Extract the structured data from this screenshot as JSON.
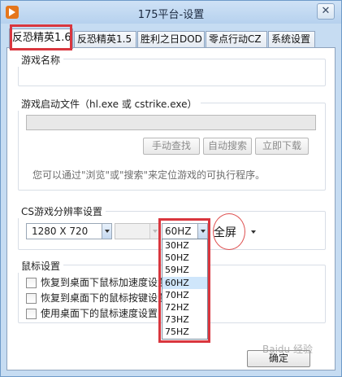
{
  "window": {
    "title": "175平台-设置",
    "close_glyph": "✕",
    "icon": "app-logo-icon"
  },
  "tabs": [
    {
      "label": "反恐精英1.6",
      "active": true
    },
    {
      "label": "反恐精英1.5",
      "active": false
    },
    {
      "label": "胜利之日DOD",
      "active": false
    },
    {
      "label": "零点行动CZ",
      "active": false
    },
    {
      "label": "系统设置",
      "active": false
    }
  ],
  "game_name_group": {
    "title": "游戏名称"
  },
  "launch_file_group": {
    "title": "游戏启动文件（hl.exe 或 cstrike.exe）",
    "path_value": "",
    "buttons": {
      "manual_find": "手动查找",
      "auto_search": "自动搜索",
      "download_now": "立即下载"
    },
    "hint": "您可以通过\"浏览\"或\"搜索\"来定位游戏的可执行程序。"
  },
  "resolution_group": {
    "title": "CS游戏分辨率设置",
    "resolution_value": "1280 X 720",
    "color_depth_value": "",
    "refresh_value": "60HZ",
    "refresh_options": [
      "30HZ",
      "50HZ",
      "59HZ",
      "60HZ",
      "70HZ",
      "72HZ",
      "73HZ",
      "75HZ"
    ],
    "refresh_selected_index": 3,
    "display_mode_value": "全屏"
  },
  "mouse_group": {
    "title": "鼠标设置",
    "options": [
      {
        "label": "恢复到桌面下鼠标加速度设置",
        "checked": false
      },
      {
        "label": "恢复到桌面下的鼠标按键设置",
        "checked": false
      },
      {
        "label": "使用桌面下的鼠标速度设置",
        "checked": false
      }
    ]
  },
  "footer": {
    "ok_label": "确定"
  },
  "watermark": "Baidu 经验",
  "colors": {
    "annotation_red": "#d9363e",
    "window_blue": "#c6dcf2",
    "selected_option": "#cfe6fb"
  }
}
